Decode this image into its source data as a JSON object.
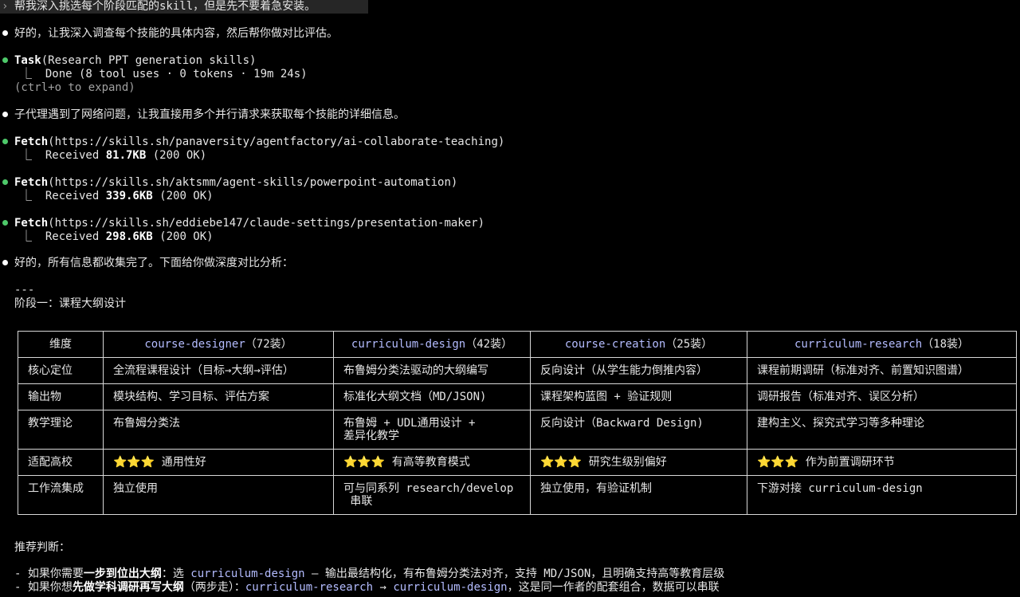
{
  "user_prompt": {
    "caret": "›",
    "text": "帮我深入挑选每个阶段匹配的skill，但是先不要着急安装。"
  },
  "msg1": "好的，让我深入调查每个技能的具体内容，然后帮你做对比评估。",
  "task": {
    "name": "Task",
    "args": "(Research PPT generation skills)",
    "result": "⎿  Done (8 tool uses · 0 tokens · 19m 24s)",
    "hint": "(ctrl+o to expand)"
  },
  "msg2": "子代理遇到了网络问题，让我直接用多个并行请求来获取每个技能的详细信息。",
  "fetches": [
    {
      "name": "Fetch",
      "args": "(https://skills.sh/panaversity/agentfactory/ai-collaborate-teaching)",
      "prefix": "⎿  Received ",
      "size": "81.7KB",
      "status": " (200 OK)"
    },
    {
      "name": "Fetch",
      "args": "(https://skills.sh/aktsmm/agent-skills/powerpoint-automation)",
      "prefix": "⎿  Received ",
      "size": "339.6KB",
      "status": " (200 OK)"
    },
    {
      "name": "Fetch",
      "args": "(https://skills.sh/eddiebe147/claude-settings/presentation-maker)",
      "prefix": "⎿  Received ",
      "size": "298.6KB",
      "status": " (200 OK)"
    }
  ],
  "msg3": "好的，所有信息都收集完了。下面给你做深度对比分析：",
  "separator": "---",
  "stage_title": "阶段一：课程大纲设计",
  "table": {
    "dimension_header": "维度",
    "columns": [
      {
        "name": "course-designer",
        "installs": "（72装）"
      },
      {
        "name": "curriculum-design",
        "installs": "（42装）"
      },
      {
        "name": "course-creation",
        "installs": "（25装）"
      },
      {
        "name": "curriculum-research",
        "installs": "（18装）"
      }
    ],
    "rows": [
      {
        "label": "核心定位",
        "cells": [
          "全流程课程设计（目标→大纲→评估）",
          "布鲁姆分类法驱动的大纲编写",
          "反向设计（从学生能力倒推内容）",
          "课程前期调研（标准对齐、前置知识图谱）"
        ]
      },
      {
        "label": "输出物",
        "cells": [
          "模块结构、学习目标、评估方案",
          "标准化大纲文档（MD/JSON)",
          "课程架构蓝图 + 验证规则",
          "调研报告（标准对齐、误区分析）"
        ]
      },
      {
        "label": "教学理论",
        "cells": [
          "布鲁姆分类法",
          "布鲁姆 + UDL通用设计 +\n差异化教学",
          "反向设计（Backward Design)",
          "建构主义、探究式学习等多种理论"
        ]
      },
      {
        "label": "适配高校",
        "stars": "⭐⭐⭐",
        "cells": [
          " 通用性好",
          " 有高等教育模式",
          " 研究生级别偏好",
          " 作为前置调研环节"
        ]
      },
      {
        "label": "工作流集成",
        "cells": [
          "独立使用",
          "可与同系列 research/develop\n 串联",
          "独立使用，有验证机制",
          "下游对接 curriculum-design"
        ]
      }
    ]
  },
  "recommend_title": "推荐判断：",
  "recommendations": [
    {
      "pre": "- 如果你需要",
      "bold": "一步到位出大纲",
      "mid": "：选 ",
      "link1": "curriculum-design",
      "post": " – 输出最结构化，有布鲁姆分类法对齐，支持 MD/JSON，且明确支持高等教育层级"
    },
    {
      "pre": "- 如果你想",
      "bold": "先做学科调研再写大纲",
      "mid": "（两步走）：",
      "link1": "curriculum-research",
      "arrow": " → ",
      "link2": "curriculum-design",
      "post": "，这是同一作者的配套组合，数据可以串联"
    }
  ]
}
